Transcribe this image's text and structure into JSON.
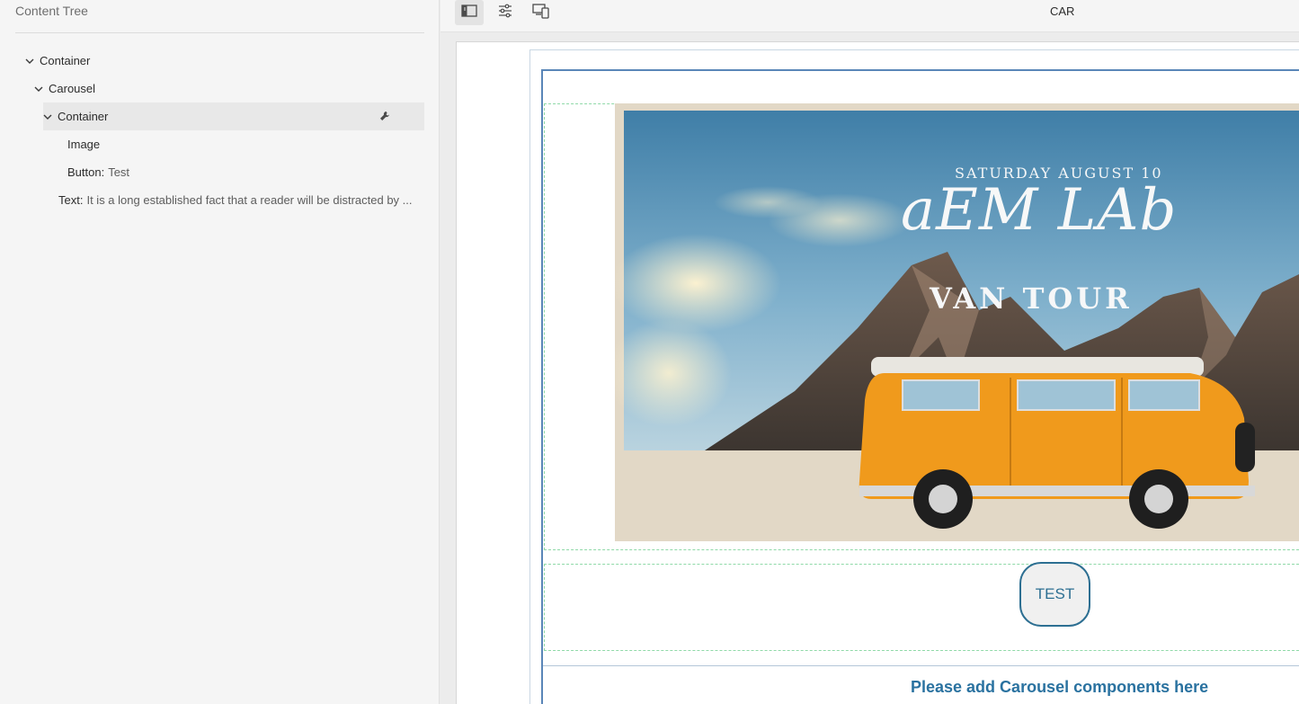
{
  "sidebar": {
    "title": "Content Tree",
    "tree": [
      {
        "label": "Container",
        "expanded": true
      },
      {
        "label": "Carousel",
        "expanded": true
      },
      {
        "label": "Container",
        "expanded": true,
        "selected": true,
        "icon": "wrench-icon"
      },
      {
        "label": "Image"
      },
      {
        "prefix": "Button:",
        "detail": "Test"
      },
      {
        "prefix": "Text:",
        "detail": "It is a long established fact that a reader will be distracted by ..."
      }
    ]
  },
  "toolbar": {
    "buttons": [
      {
        "icon": "side-panel-icon",
        "active": true
      },
      {
        "icon": "properties-sliders-icon"
      },
      {
        "icon": "device-emulator-icon"
      }
    ],
    "page_name": "CAR"
  },
  "banner": {
    "date": "SATURDAY AUGUST 10",
    "title": "aEM LAb",
    "subtitle": "VAN TOUR"
  },
  "button": {
    "label": "TEST"
  },
  "placeholder": {
    "text": "Please add Carousel components here"
  },
  "colors": {
    "accent_blue": "#2a72a0",
    "frame_blue": "#5a86b8",
    "dashed_green": "#8fd9a8",
    "van_orange": "#f09a1c"
  }
}
